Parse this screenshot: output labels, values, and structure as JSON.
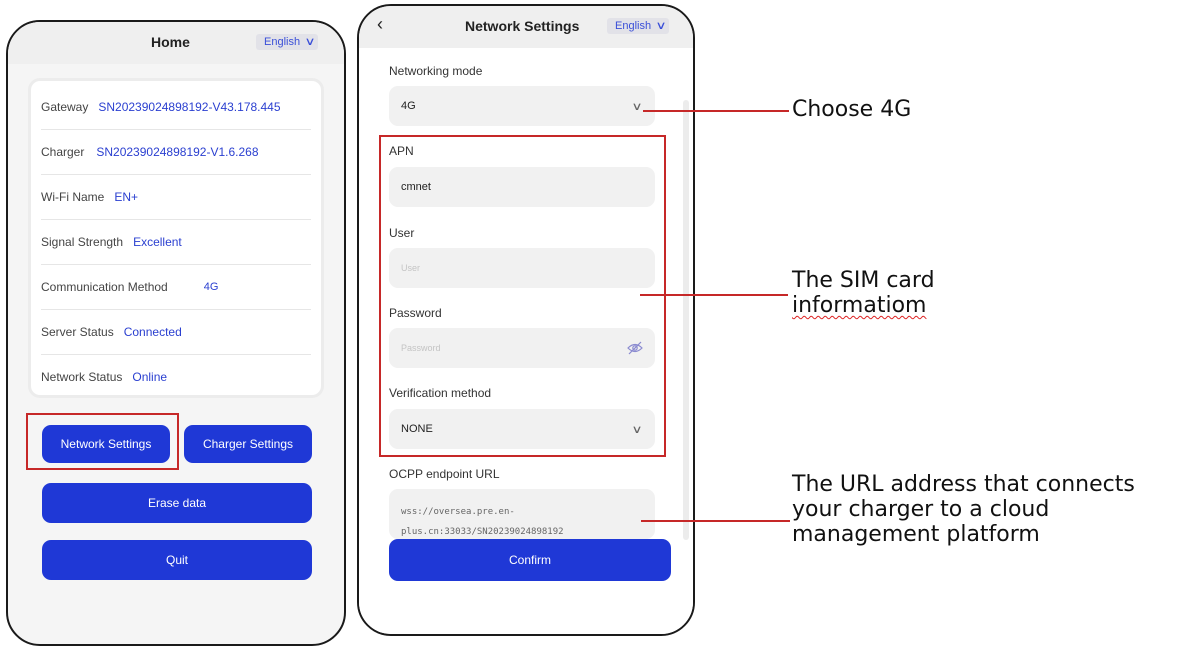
{
  "home": {
    "title": "Home",
    "language": "English",
    "info_rows": [
      {
        "label": "Gateway",
        "value": "SN20239024898192-V43.178.445"
      },
      {
        "label": "Charger",
        "value": "SN20239024898192-V1.6.268"
      },
      {
        "label": "Wi-Fi Name",
        "value": "EN+"
      },
      {
        "label": "Signal Strength",
        "value": "Excellent"
      },
      {
        "label": "Communication Method",
        "value": "4G"
      },
      {
        "label": "Server Status",
        "value": "Connected"
      },
      {
        "label": "Network Status",
        "value": "Online"
      }
    ],
    "buttons": {
      "network_settings": "Network Settings",
      "charger_settings": "Charger Settings",
      "erase_data": "Erase data",
      "quit": "Quit"
    }
  },
  "network": {
    "back_icon": "chevron-left-icon",
    "title": "Network Settings",
    "language": "English",
    "networking_mode": {
      "label": "Networking mode",
      "value": "4G"
    },
    "apn": {
      "label": "APN",
      "value": "cmnet"
    },
    "user": {
      "label": "User",
      "placeholder": "User"
    },
    "password": {
      "label": "Password",
      "placeholder": "Password",
      "icon": "eye-off-icon"
    },
    "verification_method": {
      "label": "Verification method",
      "value": "NONE"
    },
    "ocpp": {
      "label": "OCPP endpoint URL",
      "value_line1": "wss://oversea.pre.en-",
      "value_line2": "plus.cn:33033/SN20239024898192"
    },
    "confirm": "Confirm"
  },
  "annotations": {
    "choose_4g": "Choose 4G",
    "sim_line1": "The SIM card",
    "sim_line2": "informatiom",
    "url_line1": "The URL address that connects",
    "url_line2": "your charger to a cloud",
    "url_line3": "management platform"
  },
  "colors": {
    "accent": "#1f38d6",
    "highlight": "#c62828",
    "value_text": "#2a3fd0"
  }
}
